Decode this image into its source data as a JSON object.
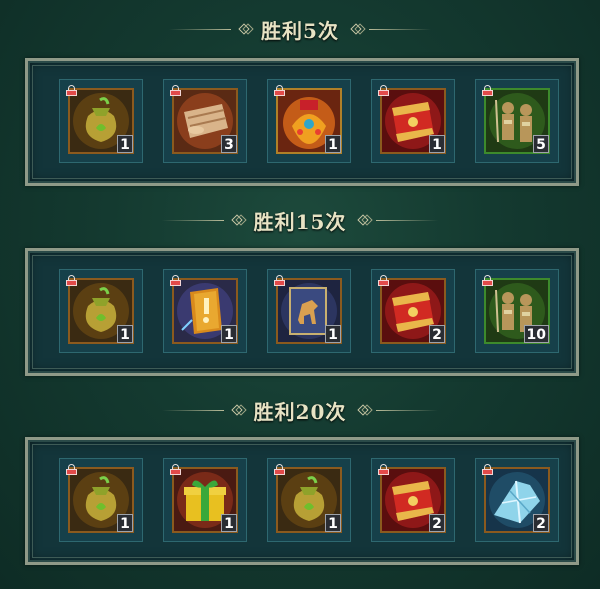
{
  "sections": [
    {
      "title": "胜利5次",
      "rewards": [
        {
          "icon": "money-bag-icon",
          "count": "1"
        },
        {
          "icon": "scroll-bundle-icon",
          "count": "3"
        },
        {
          "icon": "gold-treasure-icon",
          "count": "1"
        },
        {
          "icon": "red-banner-icon",
          "count": "1"
        },
        {
          "icon": "soldier-troop-icon",
          "count": "5"
        }
      ]
    },
    {
      "title": "胜利15次",
      "rewards": [
        {
          "icon": "money-bag-icon",
          "count": "1"
        },
        {
          "icon": "skill-book-icon",
          "count": "1"
        },
        {
          "icon": "horse-card-icon",
          "count": "1"
        },
        {
          "icon": "red-banner-icon",
          "count": "2"
        },
        {
          "icon": "soldier-troop-icon",
          "count": "10"
        }
      ]
    },
    {
      "title": "胜利20次",
      "rewards": [
        {
          "icon": "money-bag-icon",
          "count": "1"
        },
        {
          "icon": "gift-box-icon",
          "count": "1"
        },
        {
          "icon": "money-bag-icon",
          "count": "1"
        },
        {
          "icon": "red-banner-icon",
          "count": "2"
        },
        {
          "icon": "crystal-shard-icon",
          "count": "2"
        }
      ]
    }
  ]
}
